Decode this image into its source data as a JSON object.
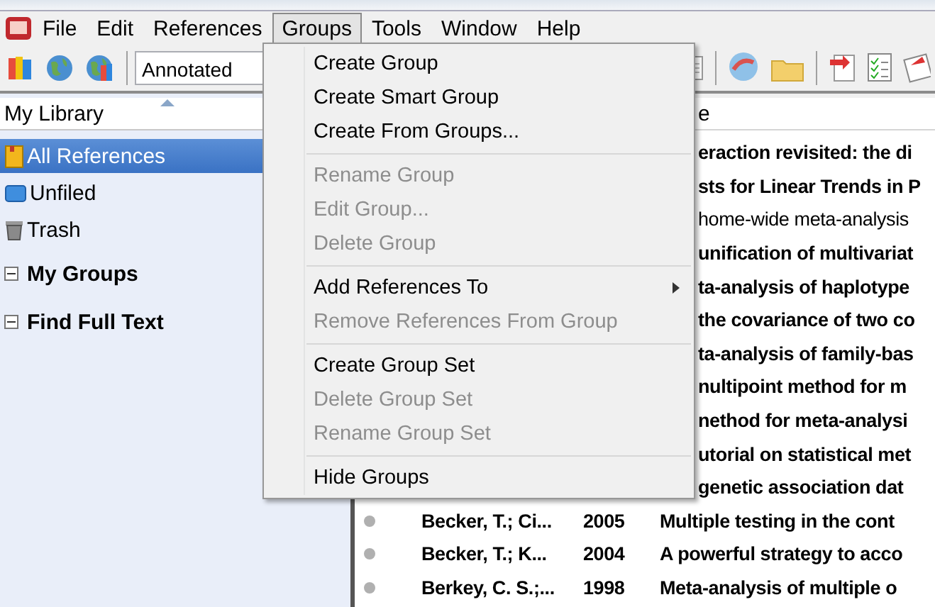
{
  "menu_bar": [
    {
      "label": "File",
      "open": false
    },
    {
      "label": "Edit",
      "open": false
    },
    {
      "label": "References",
      "open": false
    },
    {
      "label": "Groups",
      "open": true
    },
    {
      "label": "Tools",
      "open": false
    },
    {
      "label": "Window",
      "open": false
    },
    {
      "label": "Help",
      "open": false
    }
  ],
  "toolbar": {
    "style_select": {
      "value": "Annotated"
    }
  },
  "library": {
    "header": "My Library",
    "items": [
      {
        "label": "All References",
        "kind": "all",
        "selected": true
      },
      {
        "label": "Unfiled",
        "kind": "unfiled",
        "selected": false
      },
      {
        "label": "Trash",
        "kind": "trash",
        "selected": false
      }
    ],
    "groups": [
      {
        "label": "My Groups",
        "expanded": true
      },
      {
        "label": "Find Full Text",
        "expanded": true
      }
    ]
  },
  "references": {
    "column_header": "e",
    "rows": [
      {
        "title": "eraction revisited: the di",
        "unread": true,
        "covered": true
      },
      {
        "title": "sts for Linear Trends in P",
        "unread": true,
        "covered": true
      },
      {
        "title": "home-wide meta-analysis",
        "unread": false,
        "covered": true
      },
      {
        "title": "unification of multivariat",
        "unread": true,
        "covered": true
      },
      {
        "title": "ta-analysis of haplotype",
        "unread": true,
        "covered": true
      },
      {
        "title": "the covariance of two co",
        "unread": true,
        "covered": true
      },
      {
        "title": "ta-analysis of family-bas",
        "unread": true,
        "covered": true
      },
      {
        "title": "nultipoint method for m",
        "unread": true,
        "covered": true
      },
      {
        "title": "nethod for meta-analysi",
        "unread": true,
        "covered": true
      },
      {
        "title": "utorial on statistical met",
        "unread": true,
        "covered": true
      },
      {
        "title": "genetic association dat",
        "unread": true,
        "covered": true
      },
      {
        "author": "Becker, T.; Ci...",
        "year": "2005",
        "title": "Multiple testing in the cont",
        "unread": true,
        "covered": false
      },
      {
        "author": "Becker, T.; K...",
        "year": "2004",
        "title": "A powerful strategy to acco",
        "unread": true,
        "covered": false
      },
      {
        "author": "Berkey, C. S.;...",
        "year": "1998",
        "title": "Meta-analysis of multiple o",
        "unread": true,
        "covered": false
      }
    ]
  },
  "groups_menu": {
    "sections": [
      [
        {
          "label": "Create Group",
          "disabled": false,
          "submenu": false
        },
        {
          "label": "Create Smart Group",
          "disabled": false,
          "submenu": false
        },
        {
          "label": "Create From Groups...",
          "disabled": false,
          "submenu": false
        }
      ],
      [
        {
          "label": "Rename Group",
          "disabled": true,
          "submenu": false
        },
        {
          "label": "Edit Group...",
          "disabled": true,
          "submenu": false
        },
        {
          "label": "Delete Group",
          "disabled": true,
          "submenu": false
        }
      ],
      [
        {
          "label": "Add References To",
          "disabled": false,
          "submenu": true
        },
        {
          "label": "Remove References From Group",
          "disabled": true,
          "submenu": false
        }
      ],
      [
        {
          "label": "Create Group Set",
          "disabled": false,
          "submenu": false
        },
        {
          "label": "Delete Group Set",
          "disabled": true,
          "submenu": false
        },
        {
          "label": "Rename Group Set",
          "disabled": true,
          "submenu": false
        }
      ],
      [
        {
          "label": "Hide Groups",
          "disabled": false,
          "submenu": false
        }
      ]
    ]
  }
}
